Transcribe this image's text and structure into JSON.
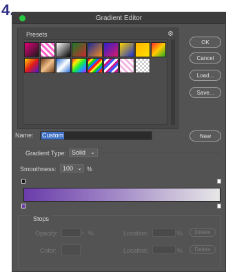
{
  "step_label": "4.",
  "window": {
    "title": "Gradient Editor"
  },
  "presets": {
    "title": "Presets"
  },
  "buttons": {
    "ok": "OK",
    "cancel": "Cancel",
    "load": "Load...",
    "save": "Save...",
    "new": "New"
  },
  "name_label": "Name:",
  "name_value": "Custom",
  "gradient_type_label": "Gradient Type:",
  "gradient_type_value": "Solid",
  "smoothness_label": "Smoothness:",
  "smoothness_value": "100",
  "smoothness_unit": "%",
  "stops": {
    "title": "Stops",
    "opacity_label": "Opacity:",
    "opacity_unit": "%",
    "color_label": "Color:",
    "location_label": "Location:",
    "location_unit": "%",
    "delete_label": "Delete"
  },
  "colors": {
    "gradient_start": "#6a3cab",
    "gradient_end": "#e7e7e7",
    "selection": "#3d70c4",
    "window_bg": "#535353"
  },
  "icons": {
    "gear": "gear-icon",
    "close": "close-icon"
  }
}
